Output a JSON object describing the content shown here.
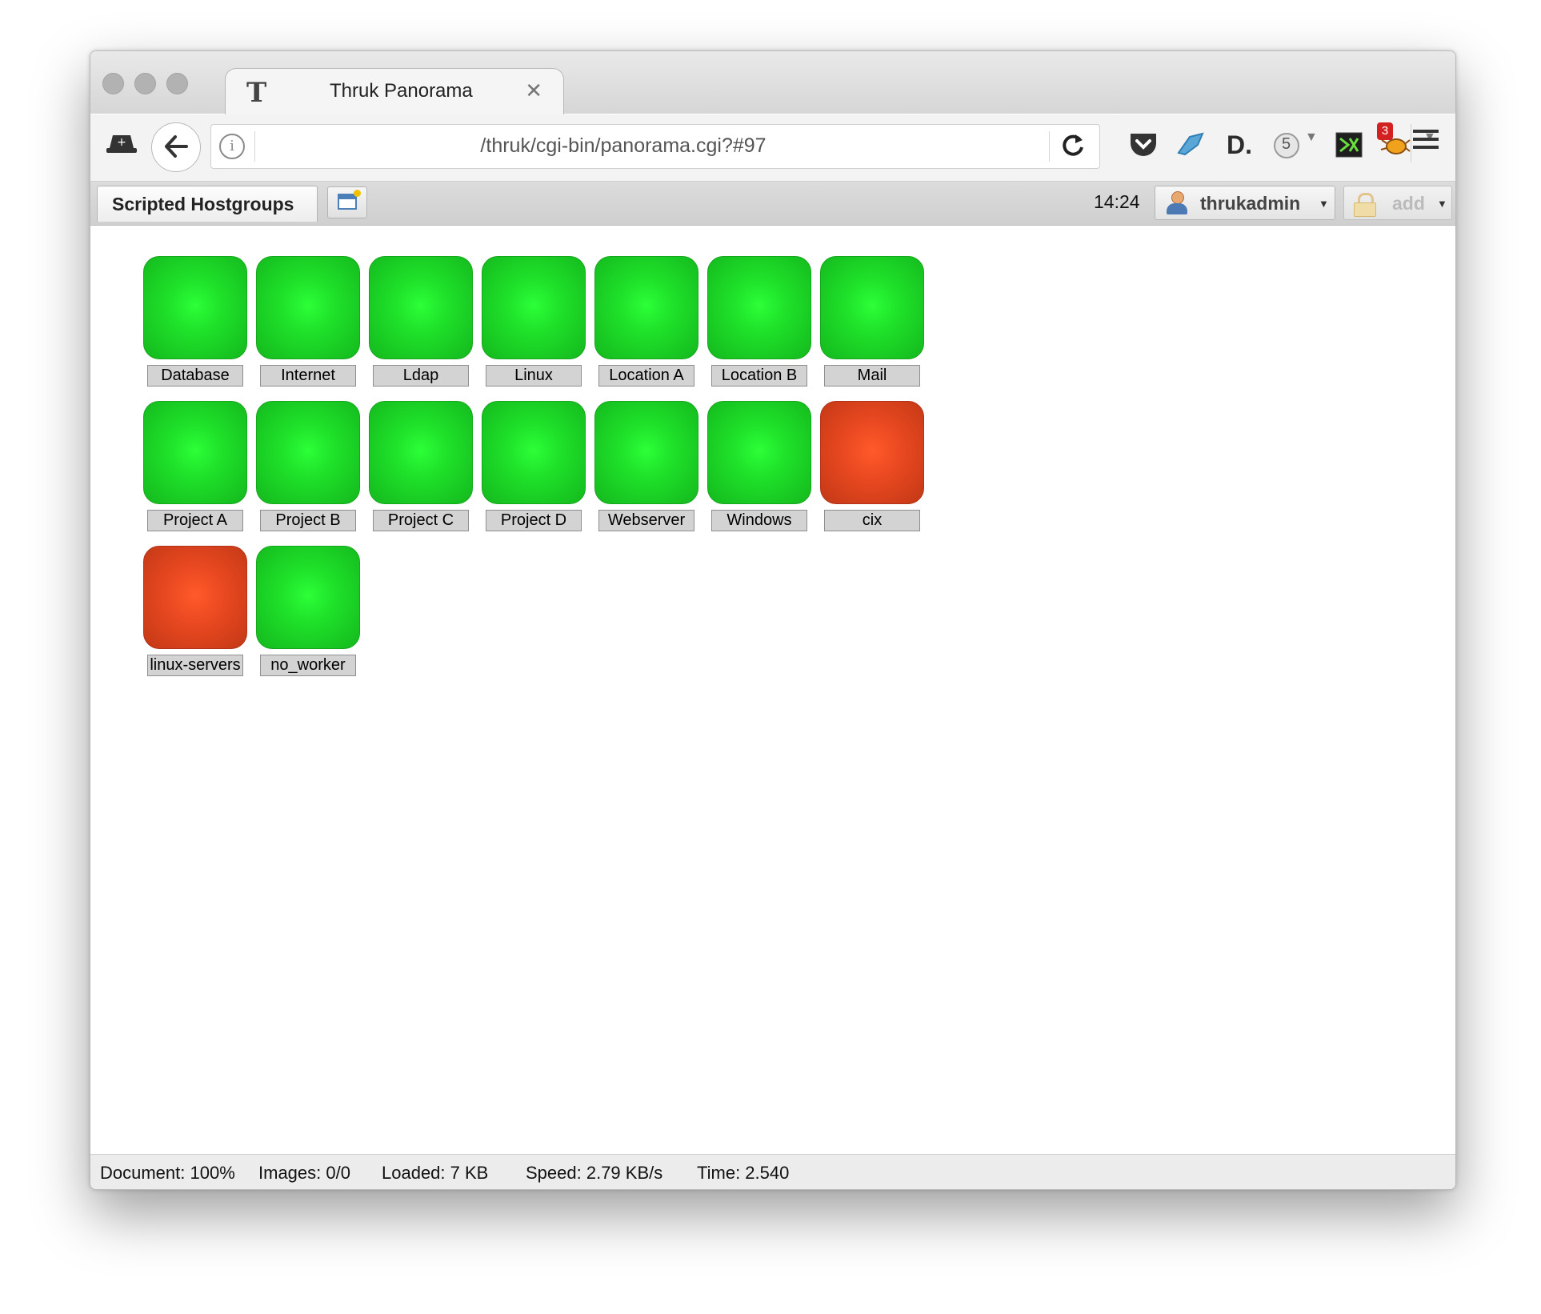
{
  "browser": {
    "tab_title": "Thruk Panorama",
    "tab_favicon": "T",
    "url": "/thruk/cgi-bin/panorama.cgi?#97",
    "toolbar_icons": [
      "incognito-icon",
      "pocket-icon",
      "bird-icon",
      "d-icon",
      "counter-icon",
      "terminal-icon",
      "bug-icon",
      "hamburger-menu-icon"
    ],
    "counter_badge": "5",
    "notification_badge": "3",
    "d_icon_text": "D."
  },
  "app": {
    "dashboard_tab": "Scripted Hostgroups",
    "clock": "14:24",
    "user": "thrukadmin",
    "add_button": "add"
  },
  "hostgroups": [
    {
      "name": "Database",
      "status": "ok"
    },
    {
      "name": "Internet",
      "status": "ok"
    },
    {
      "name": "Ldap",
      "status": "ok"
    },
    {
      "name": "Linux",
      "status": "ok"
    },
    {
      "name": "Location A",
      "status": "ok"
    },
    {
      "name": "Location B",
      "status": "ok"
    },
    {
      "name": "Mail",
      "status": "ok"
    },
    {
      "name": "Project A",
      "status": "ok"
    },
    {
      "name": "Project B",
      "status": "ok"
    },
    {
      "name": "Project C",
      "status": "ok"
    },
    {
      "name": "Project D",
      "status": "ok"
    },
    {
      "name": "Webserver",
      "status": "ok"
    },
    {
      "name": "Windows",
      "status": "ok"
    },
    {
      "name": "cix",
      "status": "critical"
    },
    {
      "name": "linux-servers",
      "status": "critical"
    },
    {
      "name": "no_worker",
      "status": "ok"
    }
  ],
  "status_colors": {
    "ok": "#1fe22a",
    "critical": "#ec4a22"
  },
  "statusbar": {
    "document": "Document: 100%",
    "images": "Images: 0/0",
    "loaded": "Loaded: 7 KB",
    "speed": "Speed: 2.79 KB/s",
    "time": "Time: 2.540"
  }
}
